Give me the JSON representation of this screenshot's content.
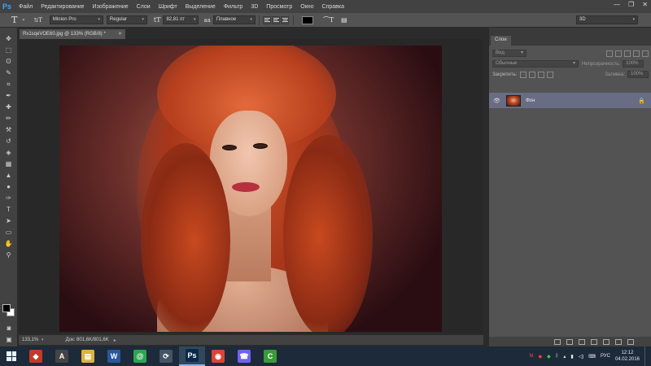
{
  "app": {
    "logo": "Ps"
  },
  "menu": [
    "Файл",
    "Редактирование",
    "Изображение",
    "Слои",
    "Шрифт",
    "Выделение",
    "Фильтр",
    "3D",
    "Просмотр",
    "Окно",
    "Справка"
  ],
  "window_controls": {
    "minimize": "—",
    "restore": "❐",
    "close": "✕"
  },
  "options": {
    "tool_icon": "T",
    "orient_icon": "⇅T",
    "font_family": "Minion Pro",
    "font_style": "Regular",
    "size_icon": "tT",
    "font_size": "82,81 пт",
    "aa_icon": "aa",
    "antialias": "Плавное",
    "workspace": "3D",
    "text_color": "#000000"
  },
  "document": {
    "tab_title": "Rx1sqeVOE60.jpg @ 133% (RGB/8) *",
    "zoom": "133,1%",
    "doc_info": "Док: 801,6K/801,6K"
  },
  "tools": [
    "move-tool",
    "marquee-tool",
    "lasso-tool",
    "quick-select-tool",
    "crop-tool",
    "eyedropper-tool",
    "healing-tool",
    "brush-tool",
    "clone-tool",
    "history-brush-tool",
    "eraser-tool",
    "gradient-tool",
    "blur-tool",
    "dodge-tool",
    "pen-tool",
    "type-tool",
    "path-select-tool",
    "shape-tool",
    "hand-tool",
    "zoom-tool"
  ],
  "tool_glyphs": [
    "✥",
    "⬚",
    "ʘ",
    "✎",
    "⌗",
    "✒",
    "✚",
    "✏",
    "⚒",
    "↺",
    "◈",
    "▦",
    "▲",
    "●",
    "✑",
    "T",
    "➤",
    "▭",
    "✋",
    "⚲"
  ],
  "layers_panel": {
    "tab": "Слои",
    "filter": "Вид",
    "blend_mode": "Обычные",
    "opacity_label": "Непрозрачность:",
    "opacity_value": "100%",
    "lock_label": "Закрепить:",
    "fill_label": "Заливка:",
    "fill_value": "100%",
    "layers": [
      {
        "name": "Фон",
        "locked": true,
        "visible": true
      }
    ]
  },
  "taskbar": {
    "apps": [
      {
        "name": "app-icon-1",
        "glyph": "◆",
        "color": "#c23a2a"
      },
      {
        "name": "app-icon-2",
        "glyph": "A",
        "color": "#444444"
      },
      {
        "name": "file-explorer",
        "glyph": "▤",
        "color": "#e0b040"
      },
      {
        "name": "word",
        "glyph": "W",
        "color": "#2b579a"
      },
      {
        "name": "app-icon-5",
        "glyph": "@",
        "color": "#2ea44f"
      },
      {
        "name": "app-icon-6",
        "glyph": "⟳",
        "color": "#445566"
      },
      {
        "name": "photoshop",
        "glyph": "Ps",
        "color": "#0b2a4a",
        "active": true
      },
      {
        "name": "chrome",
        "glyph": "◉",
        "color": "#db4437"
      },
      {
        "name": "viber",
        "glyph": "☎",
        "color": "#7360f2"
      },
      {
        "name": "camtasia",
        "glyph": "C",
        "color": "#3a9a3a"
      }
    ],
    "tray_lang": "РУС",
    "time": "12:12",
    "date": "04.02.2016"
  }
}
